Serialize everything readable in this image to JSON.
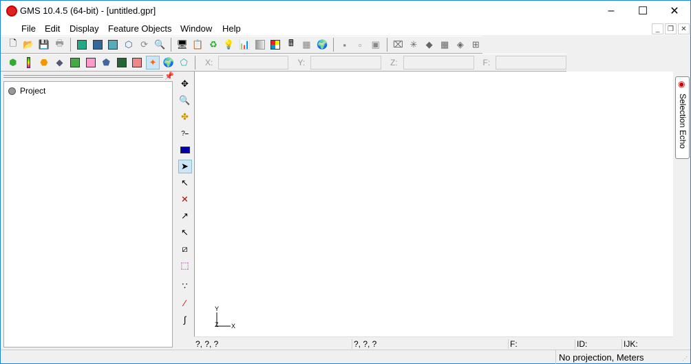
{
  "window": {
    "title": "GMS 10.4.5 (64-bit) - [untitled.gpr]",
    "minimize": "–",
    "maximize": "☐",
    "close": "✕"
  },
  "menu": [
    "File",
    "Edit",
    "Display",
    "Feature Objects",
    "Window",
    "Help"
  ],
  "mdi": {
    "minimize": "_",
    "restore": "❐",
    "close": "✕"
  },
  "coords": {
    "x": "X:",
    "y": "Y:",
    "z": "Z:",
    "f": "F:"
  },
  "tree": {
    "root": "Project"
  },
  "status": {
    "pos1": "?, ?, ?",
    "pos2": "?, ?, ?",
    "f": "F:",
    "id": "ID:",
    "ijk": "IJK:",
    "projection": "No projection, Meters"
  },
  "selection_echo": "Selection Echo",
  "axes": {
    "y": "Y",
    "x": "X",
    "z": "Z"
  }
}
